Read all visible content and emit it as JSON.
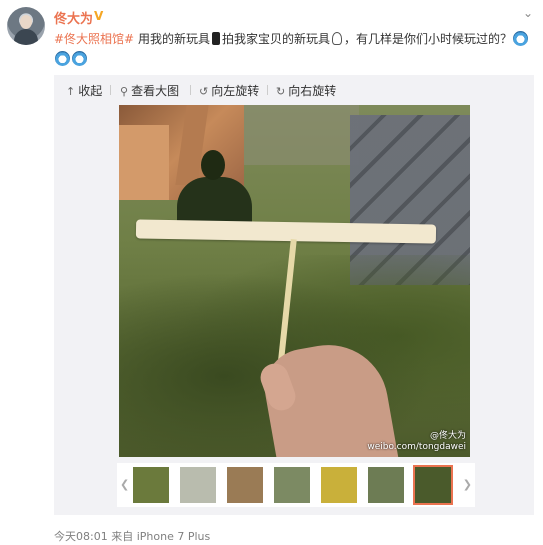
{
  "user": {
    "name": "佟大为",
    "verified_icon": "v-badge-icon"
  },
  "post": {
    "tag": "#佟大照相馆#",
    "text_1": "用我的新玩具",
    "text_2": "拍我家宝贝的新玩具",
    "text_3": "，有几样是你们小时候玩过的？"
  },
  "toolbar": {
    "collapse": "收起",
    "view_large": "查看大图",
    "rotate_left": "向左旋转",
    "rotate_right": "向右旋转"
  },
  "photo": {
    "watermark_user": "@佟大为",
    "watermark_url": "weibo.com/tongdawei"
  },
  "thumbnails": [
    {
      "name": "thumb-1",
      "color": "#6b7a3c"
    },
    {
      "name": "thumb-2",
      "color": "#b9bcae"
    },
    {
      "name": "thumb-3",
      "color": "#9a7b55"
    },
    {
      "name": "thumb-4",
      "color": "#7c8a63"
    },
    {
      "name": "thumb-5",
      "color": "#c9b03a"
    },
    {
      "name": "thumb-6",
      "color": "#6d7c54"
    },
    {
      "name": "thumb-7",
      "color": "#4a5a2b"
    }
  ],
  "selected_thumb_index": 6,
  "footer": {
    "time": "今天08:01",
    "source_prefix": "来自",
    "source": "iPhone 7 Plus"
  },
  "colors": {
    "accent": "#eb7350",
    "verified": "#f5a623"
  }
}
